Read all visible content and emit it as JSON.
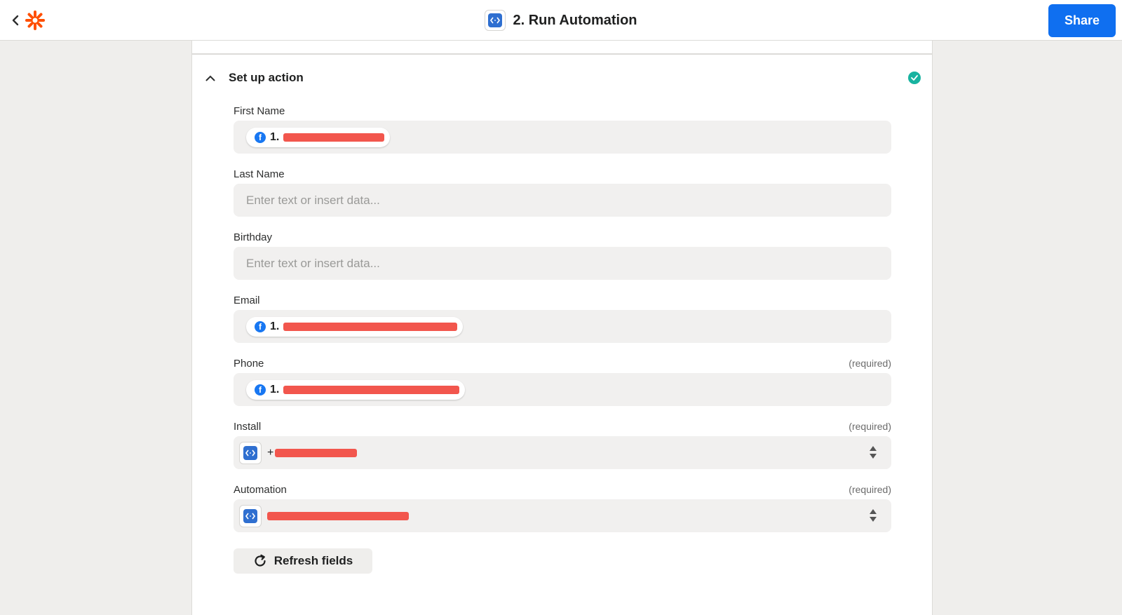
{
  "header": {
    "title": "2. Run Automation",
    "share_label": "Share"
  },
  "section": {
    "title": "Set up action",
    "status": "complete"
  },
  "fields": {
    "first_name": {
      "label": "First Name",
      "pill_step": "1."
    },
    "last_name": {
      "label": "Last Name",
      "placeholder": "Enter text or insert data..."
    },
    "birthday": {
      "label": "Birthday",
      "placeholder": "Enter text or insert data..."
    },
    "email": {
      "label": "Email",
      "pill_step": "1."
    },
    "phone": {
      "label": "Phone",
      "required": "(required)",
      "pill_step": "1."
    },
    "install": {
      "label": "Install",
      "required": "(required)",
      "prefix": "+"
    },
    "automation": {
      "label": "Automation",
      "required": "(required)"
    }
  },
  "refresh_label": "Refresh fields",
  "colors": {
    "accent": "#0f6ff0",
    "brand": "#ff4f00",
    "success": "#18b3a0",
    "facebook": "#1877f2",
    "redaction": "#f2564d"
  },
  "icons": [
    "back-chevron-icon",
    "zapier-logo-icon",
    "code-app-icon",
    "chevron-up-icon",
    "check-circle-icon",
    "facebook-icon",
    "sort-arrows-icon",
    "refresh-icon"
  ]
}
